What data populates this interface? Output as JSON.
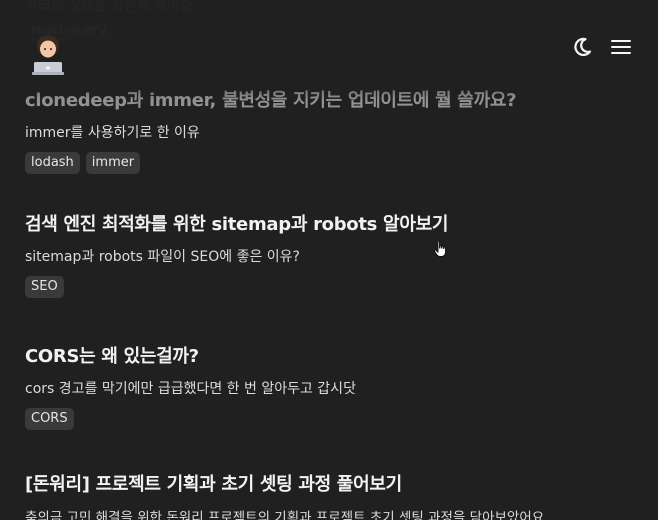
{
  "posts": [
    {
      "title": "",
      "description": "커리의 상태를 확인해 보아요",
      "tags": [
        "react-query"
      ],
      "faded": true
    },
    {
      "title": "clonedeep과 immer, 불변성을 지키는 업데이트에 뭘 쓸까요?",
      "description": "immer를 사용하기로 한 이유",
      "tags": [
        "lodash",
        "immer"
      ],
      "faded": false
    },
    {
      "title": "검색 엔진 최적화를 위한 sitemap과 robots 알아보기",
      "description": "sitemap과 robots 파일이 SEO에 좋은 이유?",
      "tags": [
        "SEO"
      ],
      "faded": false
    },
    {
      "title": "CORS는 왜 있는걸까?",
      "description": "cors 경고를 막기에만 급급했다면 한 번 알아두고 갑시닷",
      "tags": [
        "CORS"
      ],
      "faded": false
    },
    {
      "title": "[돈워리] 프로젝트 기획과 초기 셋팅 과정 풀어보기",
      "description": "축의금 고민 해결을 위한 돈워리 프로젝트의 기획과 프로젝트 초기 셋팅 과정을 담아보았어요.",
      "tags": [],
      "faded": false
    }
  ],
  "header": {
    "avatar_icon": "avatar-laptop-emoji",
    "theme_icon": "moon-icon",
    "menu_icon": "hamburger-menu-icon"
  },
  "colors": {
    "background": "#202020",
    "tag_background": "#3a3a3a",
    "text": "#f2f2f2"
  }
}
